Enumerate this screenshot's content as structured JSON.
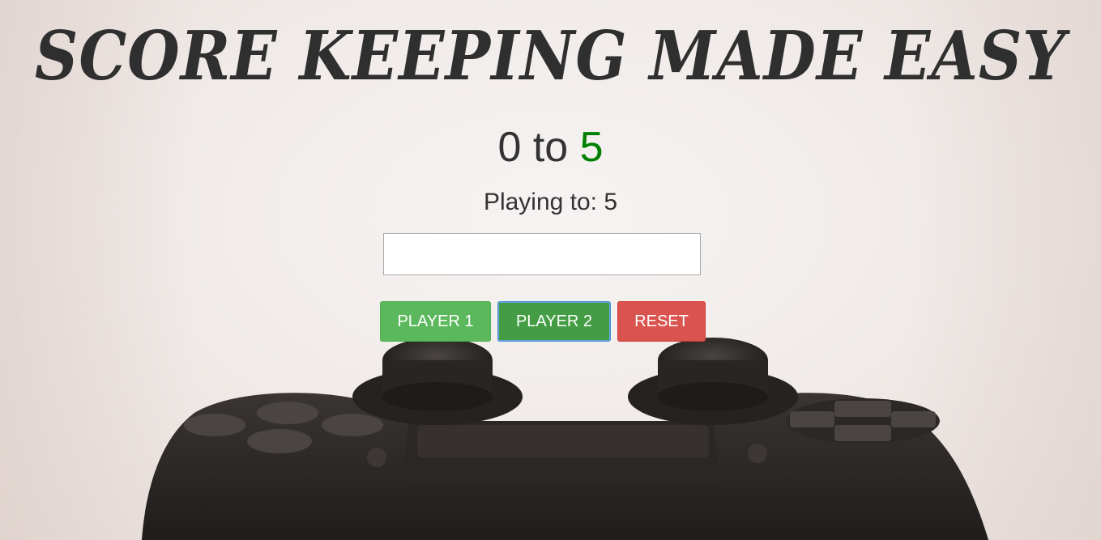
{
  "header": {
    "title": "SCORE KEEPING MADE EASY"
  },
  "scoreboard": {
    "player1_score": "0",
    "separator": "to",
    "player2_score": "5",
    "playing_to_label": "Playing to:",
    "playing_to_value": "5"
  },
  "limit_input": {
    "value": "",
    "placeholder": ""
  },
  "buttons": {
    "player1": "PLAYER 1",
    "player2": "PLAYER 2",
    "reset": "RESET"
  },
  "colors": {
    "winner": "#008000",
    "player_button": "#5cb85c",
    "player_button_active": "#449d44",
    "reset_button": "#d9534f",
    "text": "#333333"
  },
  "background": {
    "image": "game-controller-photo"
  }
}
